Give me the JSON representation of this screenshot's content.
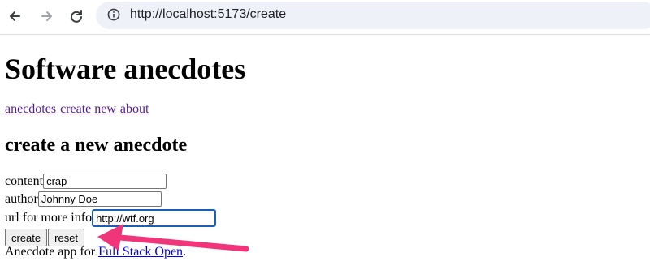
{
  "browser": {
    "url": "http://localhost:5173/create",
    "icons": [
      "back-arrow-icon",
      "forward-arrow-icon",
      "reload-icon",
      "info-icon"
    ]
  },
  "page": {
    "title": "Software anecdotes",
    "nav": [
      {
        "label": "anecdotes"
      },
      {
        "label": "create new"
      },
      {
        "label": "about"
      }
    ],
    "form": {
      "heading": "create a new anecdote",
      "content_label": "content",
      "content_value": "crap",
      "author_label": "author",
      "author_value": "Johnny Doe",
      "info_label": "url for more info",
      "info_value": "http://wtf.org",
      "create_label": "create",
      "reset_label": "reset"
    },
    "footer": {
      "prefix": "Anecdote app for ",
      "link": "Full Stack Open",
      "suffix": "."
    }
  },
  "annotation": {
    "arrow_color": "#f0357a"
  }
}
